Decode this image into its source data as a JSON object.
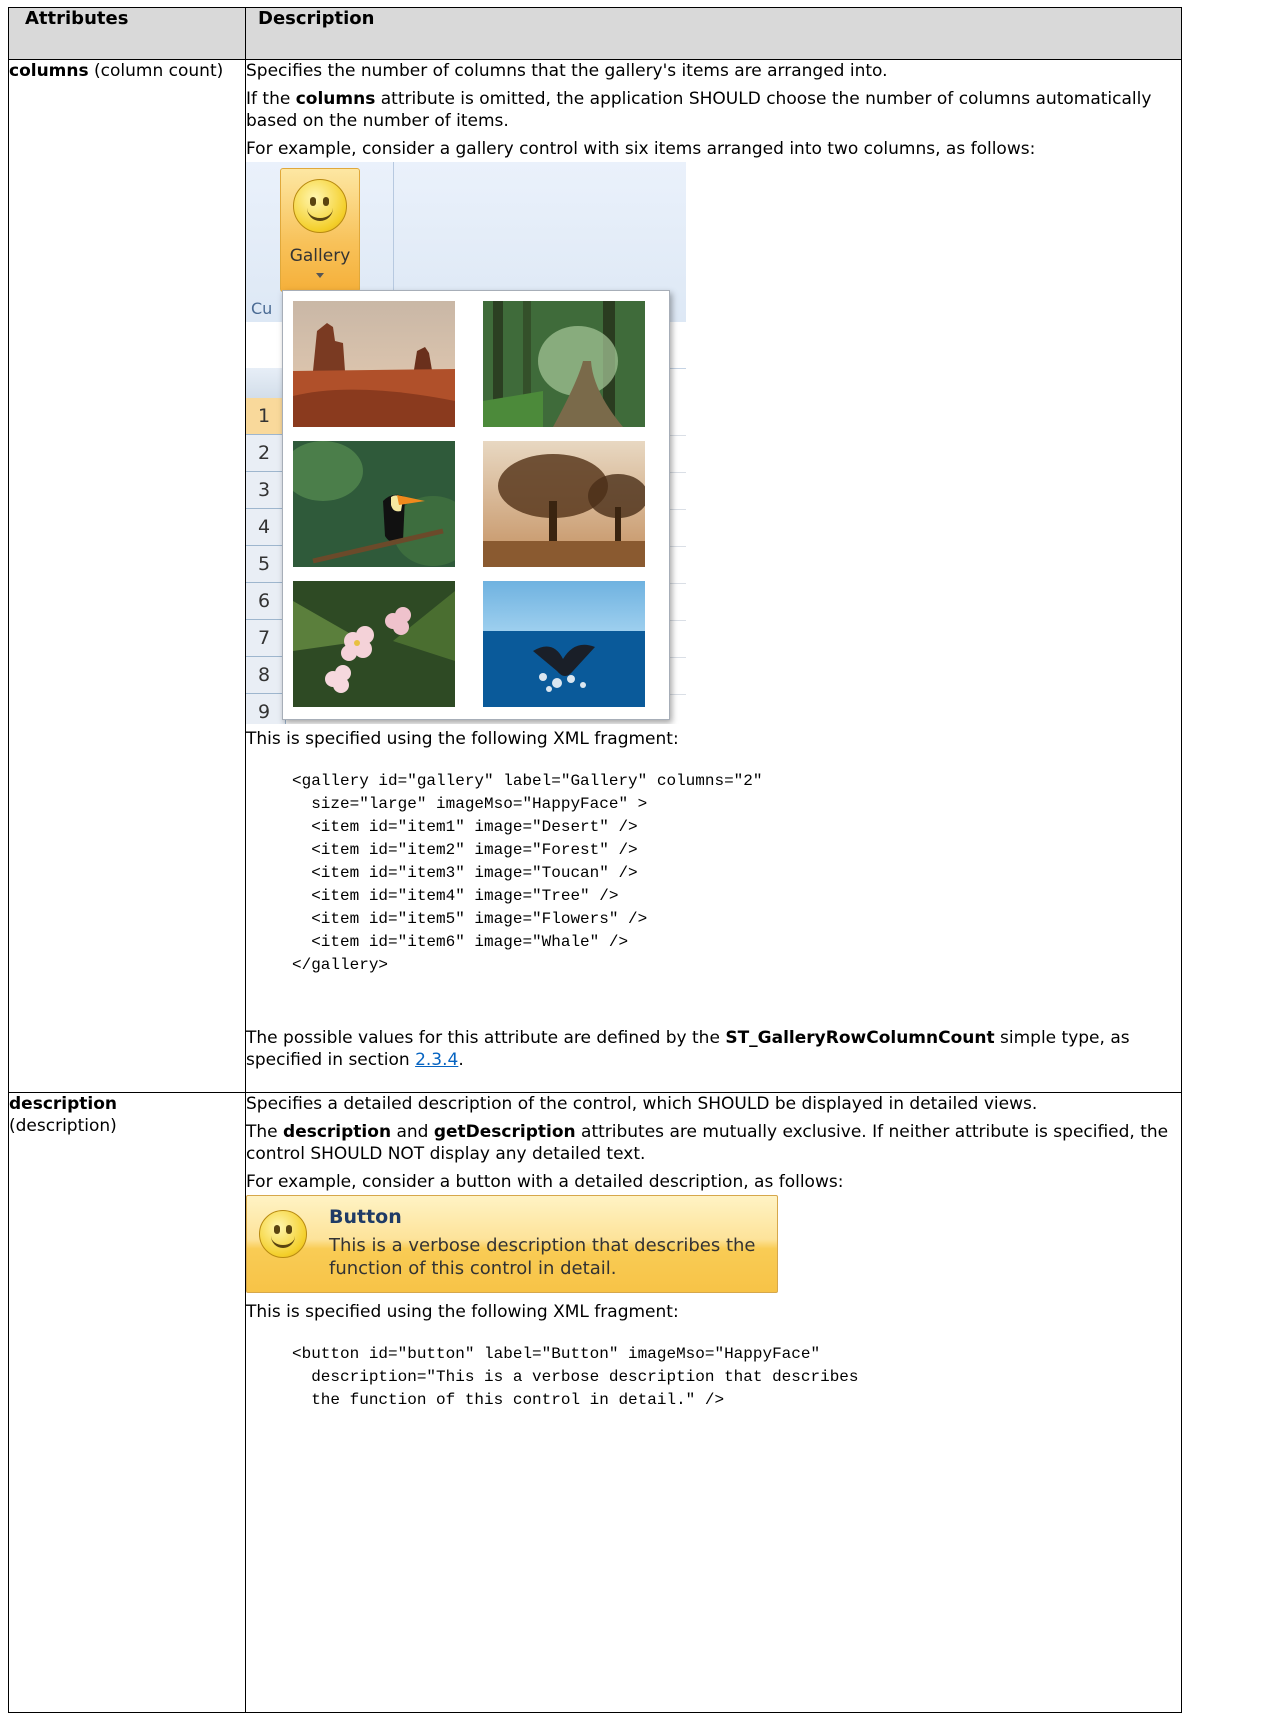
{
  "headers": {
    "attributes": "Attributes",
    "description": "Description"
  },
  "rows": [
    {
      "name_bold": "columns",
      "name_rest": " (column count)",
      "p1": "Specifies the number of columns that the gallery's items are arranged into.",
      "p2_pre": "If the ",
      "p2_bold": "columns",
      "p2_post": " attribute is omitted, the application SHOULD choose the number of columns automatically based on the number of items.",
      "p3": "For example, consider a gallery control with six items arranged into two columns, as follows:",
      "screenshot": {
        "button_label": "Gallery",
        "group_label_partial": "Cu",
        "row_numbers": [
          "1",
          "2",
          "3",
          "4",
          "5",
          "6",
          "7",
          "8",
          "9"
        ],
        "items": [
          "Desert",
          "Forest",
          "Toucan",
          "Tree",
          "Flowers",
          "Whale"
        ]
      },
      "p4": "This is specified using the following XML fragment:",
      "code": "<gallery id=\"gallery\" label=\"Gallery\" columns=\"2\"\n  size=\"large\" imageMso=\"HappyFace\" >\n  <item id=\"item1\" image=\"Desert\" />\n  <item id=\"item2\" image=\"Forest\" />\n  <item id=\"item3\" image=\"Toucan\" />\n  <item id=\"item4\" image=\"Tree\" />\n  <item id=\"item5\" image=\"Flowers\" />\n  <item id=\"item6\" image=\"Whale\" />\n</gallery>",
      "p5_pre": "The possible values for this attribute are defined by the ",
      "p5_bold": "ST_GalleryRowColumnCount",
      "p5_mid": " simple type, as specified in section ",
      "p5_link": "2.3.4",
      "p5_post": "."
    },
    {
      "name_bold": "description",
      "name_rest": "(description)",
      "p1": "Specifies a detailed description of the control, which SHOULD be displayed in detailed views.",
      "p2_pre": "The ",
      "p2_bold1": "description",
      "p2_mid": " and ",
      "p2_bold2": "getDescription",
      "p2_post": " attributes are mutually exclusive. If neither attribute is specified, the control SHOULD NOT display any detailed text.",
      "p3": "For example, consider a button with a detailed description, as follows:",
      "screenshot": {
        "title": "Button",
        "description": "This is a verbose description that describes the function of this control in detail."
      },
      "p4": "This is specified using the following XML fragment:",
      "code": "<button id=\"button\" label=\"Button\" imageMso=\"HappyFace\"\n  description=\"This is a verbose description that describes\n  the function of this control in detail.\" />"
    }
  ]
}
